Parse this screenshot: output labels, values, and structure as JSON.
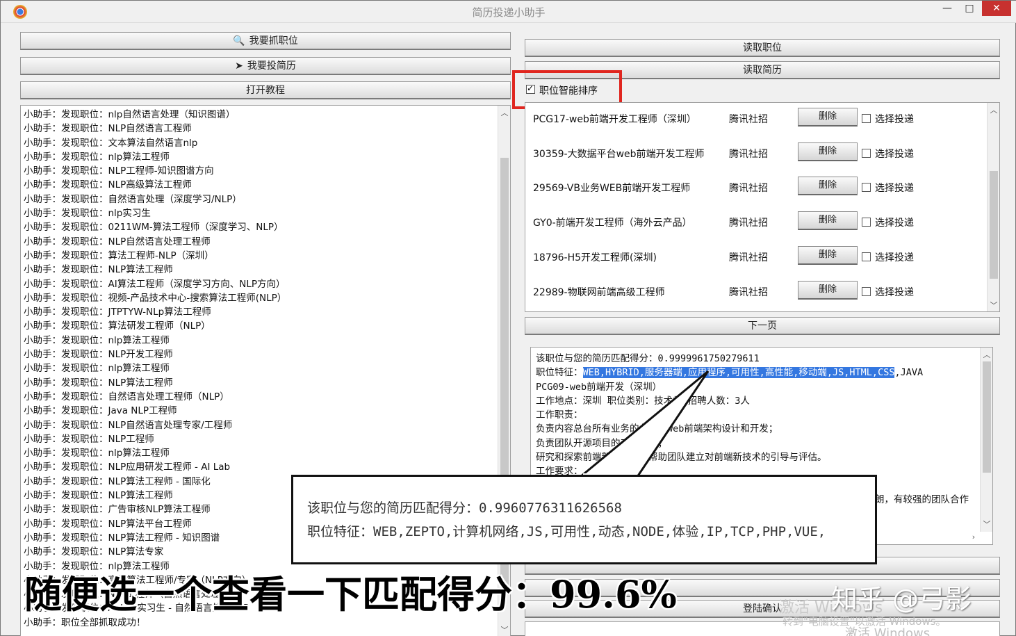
{
  "window": {
    "title": "简历投递小助手",
    "minimize": "—",
    "maximize": "□",
    "close": "✕"
  },
  "left": {
    "grab_button": "我要抓职位",
    "apply_button": "我要投简历",
    "tutorial_button": "打开教程",
    "log_lines": [
      "小助手：发现职位：nlp自然语言处理（知识图谱）",
      "小助手：发现职位：NLP自然语言工程师",
      "小助手：发现职位：文本算法自然语言nlp",
      "小助手：发现职位：nlp算法工程师",
      "小助手：发现职位：NLP工程师-知识图谱方向",
      "小助手：发现职位：NLP高级算法工程师",
      "小助手：发现职位：自然语言处理（深度学习/NLP）",
      "小助手：发现职位：nlp实习生",
      "小助手：发现职位：0211WM-算法工程师（深度学习、NLP）",
      "小助手：发现职位：NLP自然语言处理工程师",
      "小助手：发现职位：算法工程师-NLP（深圳）",
      "小助手：发现职位：NLP算法工程师",
      "小助手：发现职位：AI算法工程师（深度学习方向、NLP方向）",
      "小助手：发现职位：视频-产品技术中心-搜索算法工程师(NLP）",
      "小助手：发现职位：JTPTYW-NLp算法工程师",
      "小助手：发现职位：算法研发工程师（NLP）",
      "小助手：发现职位：nlp算法工程师",
      "小助手：发现职位：NLP开发工程师",
      "小助手：发现职位：nlp算法工程师",
      "小助手：发现职位：NLP算法工程师",
      "小助手：发现职位：自然语言处理工程师（NLP）",
      "小助手：发现职位：Java NLP工程师",
      "小助手：发现职位：NLP自然语言处理专家/工程师",
      "小助手：发现职位：NLP工程师",
      "小助手：发现职位：nlp算法工程师",
      "小助手：发现职位：NLP应用研发工程师 - AI Lab",
      "小助手：发现职位：NLP算法工程师 - 国际化",
      "小助手：发现职位：NLP算法工程师",
      "小助手：发现职位：广告审核NLP算法工程师",
      "小助手：发现职位：NLP算法平台工程师",
      "小助手：发现职位：NLP算法工程师 - 知识图谱",
      "小助手：发现职位：NLP算法专家",
      "小助手：发现职位：nlp算法工程师",
      "小助手：发现职位：高级算法工程师/专家（NLP方向）",
      "小助手：发现职位：NLP工程师（自然语言处理）",
      "小助手：发现职位：AI Lab实习生 - 自然语言处理NLP",
      "小助手：职位全部抓取成功！"
    ]
  },
  "right": {
    "read_jobs_button": "读取职位",
    "read_resume_button": "读取简历",
    "smart_sort_label": "职位智能排序",
    "smart_sort_checked": true,
    "jobs": [
      {
        "title": "PCG17-web前端开发工程师（深圳）",
        "source": "腾讯社招",
        "delete": "删除",
        "select": "选择投递"
      },
      {
        "title": "30359-大数据平台web前端开发工程师",
        "source": "腾讯社招",
        "delete": "删除",
        "select": "选择投递"
      },
      {
        "title": "29569-VB业务WEB前端开发工程师",
        "source": "腾讯社招",
        "delete": "删除",
        "select": "选择投递"
      },
      {
        "title": "GY0-前端开发工程师（海外云产品）",
        "source": "腾讯社招",
        "delete": "删除",
        "select": "选择投递"
      },
      {
        "title": "18796-H5开发工程师(深圳)",
        "source": "腾讯社招",
        "delete": "删除",
        "select": "选择投递"
      },
      {
        "title": "22989-物联网前端高级工程师",
        "source": "腾讯社招",
        "delete": "删除",
        "select": "选择投递"
      }
    ],
    "next_page_button": "下一页",
    "detail": {
      "line1": "该职位与您的简历匹配得分：0.9999961750279611",
      "line2_prefix": "职位特征：",
      "line2_highlight": "WEB,HYBRID,服务器端,应用程序,可用性,高性能,移动端,JS,HTML,CSS",
      "line2_suffix": ",JAVA",
      "line3": "PCG09-web前端开发（深圳）",
      "line4": "工作地点：深圳  职位类别：技术类  招聘人数：3人",
      "line5": "工作职责：",
      "line6": "负责内容总台所有业务的业务的web前端架构设计和开发；",
      "line7": "负责团队开源项目的工具研发；",
      "line8": "研究和探索前端新技术，能帮助团队建立对前端新技术的引导与评估。",
      "line9": "工作要求：",
      "line11": "朗，有较强的团队合作"
    },
    "login_button": "登陆确认"
  },
  "callout": {
    "line1": "该职位与您的简历匹配得分：0.9960776311626568",
    "line2": "职位特征：WEB,ZEPTO,计算机网络,JS,可用性,动态,NODE,体验,IP,TCP,PHP,VUE,"
  },
  "overlay": {
    "caption": "随便选一个查看一下匹配得分：99.6%",
    "watermark": "知乎 @弓影",
    "activate1": "激活 Windows",
    "activate2": "转到\"电脑设置\"以激活 Windows。",
    "activate3": "激活 Windows"
  },
  "colors": {
    "highlight": "#3477e0",
    "red_box": "#e0261f",
    "close": "#c7312f"
  }
}
